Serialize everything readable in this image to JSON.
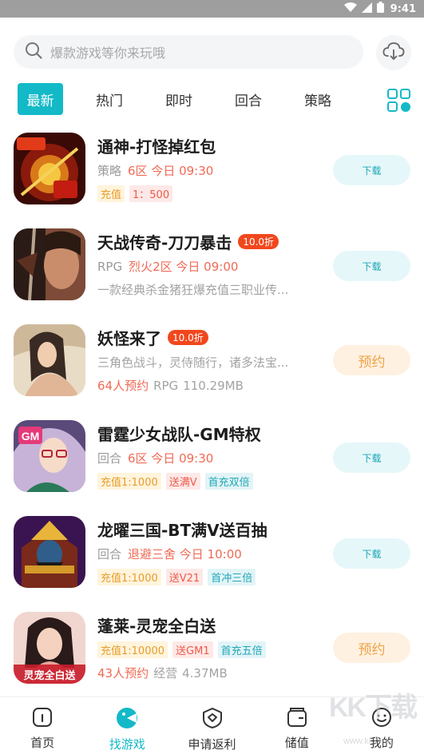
{
  "status_bar": {
    "time": "9:41",
    "icons": [
      "wifi-icon",
      "signal-icon",
      "battery-icon"
    ]
  },
  "search": {
    "placeholder": "爆款游戏等你来玩哦",
    "icon": "search-icon",
    "download_icon": "cloud-download-icon"
  },
  "tabs": [
    {
      "label": "最新",
      "active": true
    },
    {
      "label": "热门",
      "active": false
    },
    {
      "label": "即时",
      "active": false
    },
    {
      "label": "回合",
      "active": false
    },
    {
      "label": "策略",
      "active": false
    }
  ],
  "grid_icon": "grid-icon",
  "games": [
    {
      "title": "通神-打怪掉红包",
      "discount": "",
      "type": "策略",
      "server": "6区 今日 09:30",
      "tags": [
        {
          "text": "充值",
          "color": "r"
        },
        {
          "text": "1：500",
          "color": "r"
        }
      ],
      "button": "下载",
      "icon_desc": "red-envelope-game-icon"
    },
    {
      "title": "天战传奇-刀刀暴击",
      "discount": "10.0折",
      "type": "RPG",
      "server": "烈火2区 今日 09:00",
      "desc": "一款经典杀金猪狂爆充值三职业传...",
      "button": "下载",
      "icon_desc": "warrior-game-icon"
    },
    {
      "title": "妖怪来了",
      "discount": "10.0折",
      "desc": "三角色战斗，灵侍随行，诸多法宝...",
      "appointments": "64人预约",
      "type": "RPG",
      "size": "110.29MB",
      "button": "预约",
      "icon_desc": "fairy-game-icon"
    },
    {
      "title": "雷霆少女战队-GM特权",
      "discount": "",
      "type": "回合",
      "server": "6区 今日 09:30",
      "tags": [
        {
          "text": "充值1:1000",
          "color": "o"
        },
        {
          "text": "送满V",
          "color": "r"
        },
        {
          "text": "首充双倍",
          "color": "c"
        }
      ],
      "button": "下载",
      "icon_desc": "anime-girl-game-icon",
      "icon_badge": "GM"
    },
    {
      "title": "龙曜三国-BT满V送百抽",
      "discount": "",
      "type": "回合",
      "server": "退避三舍 今日 10:00",
      "tags": [
        {
          "text": "充值1:1000",
          "color": "o"
        },
        {
          "text": "送V21",
          "color": "r"
        },
        {
          "text": "首冲三倍",
          "color": "c"
        }
      ],
      "button": "下载",
      "icon_desc": "three-kingdoms-game-icon"
    },
    {
      "title": "蓬莱-灵宠全白送",
      "discount": "",
      "tags": [
        {
          "text": "充值1:10000",
          "color": "o"
        },
        {
          "text": "送GM1",
          "color": "r"
        },
        {
          "text": "首充五倍",
          "color": "c"
        }
      ],
      "appointments": "43人预约",
      "type": "经营",
      "size": "4.37MB",
      "button": "预约",
      "icon_desc": "penglai-game-icon",
      "icon_caption": "灵宠全白送"
    }
  ],
  "bottom_nav": [
    {
      "label": "首页",
      "icon": "home-icon",
      "active": false
    },
    {
      "label": "找游戏",
      "icon": "game-find-icon",
      "active": true
    },
    {
      "label": "申请返利",
      "icon": "rebate-shield-icon",
      "active": false
    },
    {
      "label": "储值",
      "icon": "wallet-icon",
      "active": false
    },
    {
      "label": "我的",
      "icon": "profile-icon",
      "active": false
    }
  ],
  "watermark": {
    "big": "KK下载",
    "small": "www.kkx.net"
  },
  "colors": {
    "accent": "#13b9c7",
    "red": "#f06a55",
    "orange": "#f0a347",
    "download_bg": "#e6f7f9"
  }
}
